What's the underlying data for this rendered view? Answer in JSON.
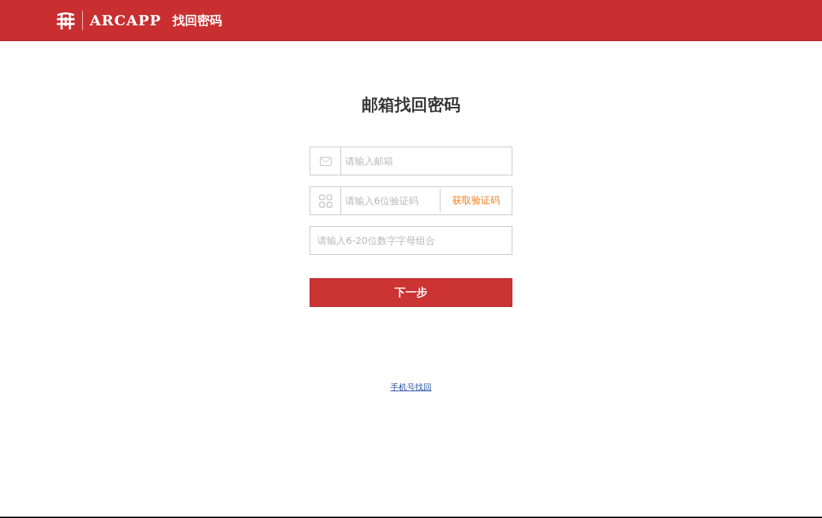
{
  "header": {
    "logo_text": "ARCAPP",
    "page_title": "找回密码"
  },
  "title": "邮箱找回密码",
  "form": {
    "fields": [
      {
        "kind": "email",
        "placeholder": "请输入邮箱"
      },
      {
        "kind": "code",
        "placeholder": "请输入6位验证码",
        "action": "获取验证码"
      },
      {
        "kind": "password",
        "placeholder": "请输入6-20位数字字母组合"
      }
    ],
    "submit": "下一步"
  },
  "alt_link": "手机号找回"
}
